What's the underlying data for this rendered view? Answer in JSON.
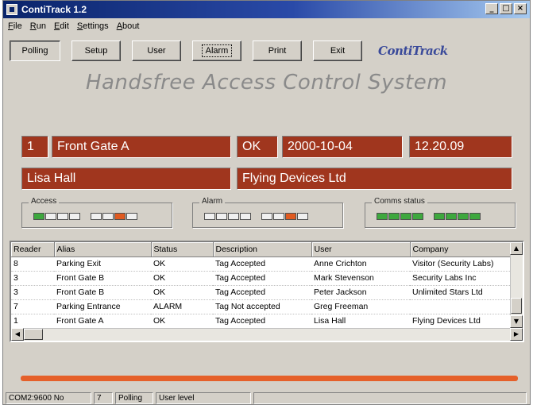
{
  "window": {
    "title": "ContiTrack 1.2",
    "controls": [
      "_",
      "□",
      "×"
    ]
  },
  "menu": [
    "File",
    "Run",
    "Edit",
    "Settings",
    "About"
  ],
  "toolbar": {
    "buttons": [
      "Polling",
      "Setup",
      "User",
      "Alarm",
      "Print",
      "Exit"
    ],
    "logo_text": "ContiTrack"
  },
  "banner": "Handsfree Access Control System",
  "current_event": {
    "reader_id": "1",
    "alias": "Front Gate A",
    "status": "OK",
    "date": "2000-10-04",
    "time": "12.20.09",
    "user": "Lisa Hall",
    "company": "Flying Devices Ltd"
  },
  "indicators": {
    "access_label": "Access",
    "alarm_label": "Alarm",
    "comms_label": "Comms status",
    "access_leds": [
      "green",
      "off",
      "off",
      "off",
      "off",
      "off",
      "orange",
      "off"
    ],
    "alarm_leds": [
      "off",
      "off",
      "off",
      "off",
      "off",
      "off",
      "orange",
      "off"
    ],
    "comms_leds": [
      "green",
      "green",
      "green",
      "green",
      "green",
      "green",
      "green",
      "green"
    ]
  },
  "log_table": {
    "columns": [
      "Reader",
      "Alias",
      "Status",
      "Description",
      "User",
      "Company"
    ],
    "rows": [
      [
        "8",
        "Parking Exit",
        "OK",
        "Tag Accepted",
        "Anne Crichton",
        "Visitor (Security Labs)"
      ],
      [
        "3",
        "Front Gate B",
        "OK",
        "Tag Accepted",
        "Mark Stevenson",
        "Security Labs Inc"
      ],
      [
        "3",
        "Front Gate B",
        "OK",
        "Tag Accepted",
        "Peter Jackson",
        "Unlimited Stars Ltd"
      ],
      [
        "7",
        "Parking Entrance",
        "ALARM",
        "Tag Not accepted",
        "Greg Freeman",
        ""
      ],
      [
        "1",
        "Front Gate A",
        "OK",
        "Tag Accepted",
        "Lisa Hall",
        "Flying Devices Ltd"
      ]
    ]
  },
  "colors": {
    "panel_red": "#a0361e",
    "progress_orange": "#e5602a",
    "led_green": "#3ea83e",
    "led_orange": "#e05a20"
  },
  "statusbar": [
    "COM2:9600 No",
    "7",
    "Polling",
    "User level"
  ]
}
